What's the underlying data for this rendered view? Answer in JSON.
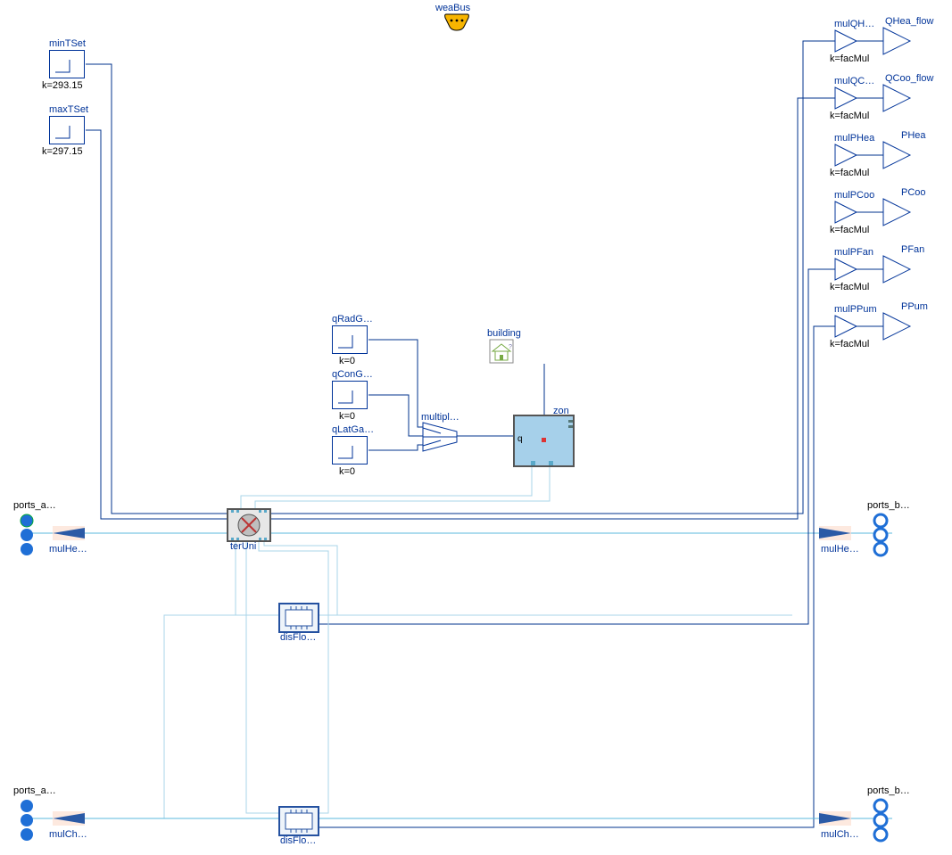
{
  "weaBus": {
    "label": "weaBus"
  },
  "constants": {
    "minTSet": {
      "label": "minTSet",
      "k": "k=293.15"
    },
    "maxTSet": {
      "label": "maxTSet",
      "k": "k=297.15"
    },
    "qRadG": {
      "label": "qRadG…",
      "k": "k=0"
    },
    "qConG": {
      "label": "qConG…",
      "k": "k=0"
    },
    "qLatGa": {
      "label": "qLatGa…",
      "k": "k=0"
    }
  },
  "gains": {
    "mulQH": {
      "label": "mulQH…",
      "k": "k=facMul",
      "out": "QHea_flow"
    },
    "mulQC": {
      "label": "mulQC…",
      "k": "k=facMul",
      "out": "QCoo_flow"
    },
    "mulPHea": {
      "label": "mulPHea",
      "k": "k=facMul",
      "out": "PHea"
    },
    "mulPCoo": {
      "label": "mulPCoo",
      "k": "k=facMul",
      "out": "PCoo"
    },
    "mulPFan": {
      "label": "mulPFan",
      "k": "k=facMul",
      "out": "PFan"
    },
    "mulPPum": {
      "label": "mulPPum",
      "k": "k=facMul",
      "out": "PPum"
    }
  },
  "multiplex": {
    "label": "multipl…"
  },
  "building": {
    "label": "building"
  },
  "zon": {
    "label": "zon",
    "qlabel": "q"
  },
  "terUni": {
    "label": "terUni"
  },
  "disFloHea": {
    "label": "disFlo…"
  },
  "disFloCoo": {
    "label": "disFlo…"
  },
  "ports": {
    "a1": {
      "label": "ports_a…",
      "mul": "mulHe…"
    },
    "b1": {
      "label": "ports_b…",
      "mul": "mulHe…"
    },
    "a2": {
      "label": "ports_a…",
      "mul": "mulCh…"
    },
    "b2": {
      "label": "ports_b…",
      "mul": "mulCh…"
    }
  }
}
